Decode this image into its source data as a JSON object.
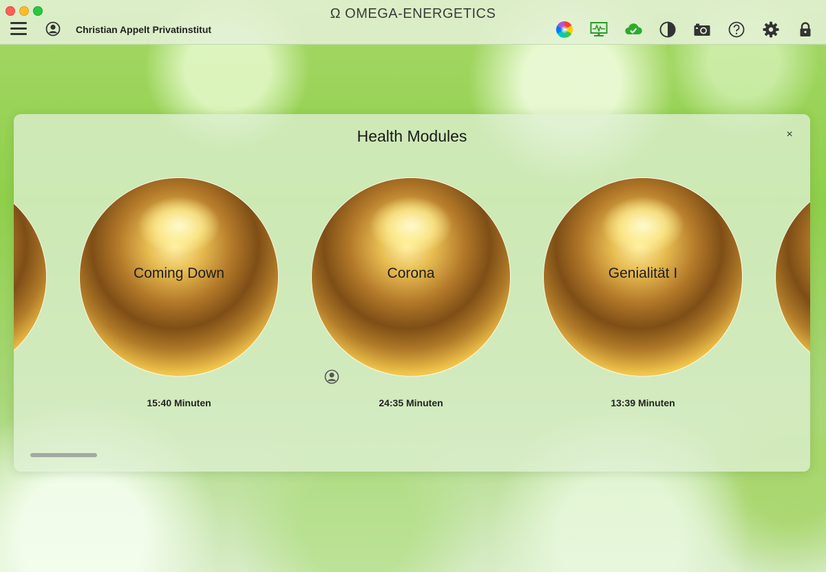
{
  "window": {
    "app_title": "Ω OMEGA-ENERGETICS",
    "organization": "Christian Appelt Privatinstitut"
  },
  "toolbar": {
    "icons": [
      "menu-icon",
      "user-icon",
      "color-wheel-icon",
      "monitor-chart-icon",
      "cloud-check-icon",
      "contrast-icon",
      "camera-icon",
      "help-icon",
      "gear-icon",
      "lock-icon"
    ],
    "colors": {
      "cloud_check": "#2bab2b",
      "monitor": "#2a9a2a"
    }
  },
  "modal": {
    "title": "Health Modules",
    "close_label": "×",
    "modules": [
      {
        "name": "Coming Down",
        "duration": "15:40 Minuten"
      },
      {
        "name": "Corona",
        "duration": "24:35 Minuten"
      },
      {
        "name": "Genialität I",
        "duration": "13:39 Minuten"
      }
    ]
  }
}
